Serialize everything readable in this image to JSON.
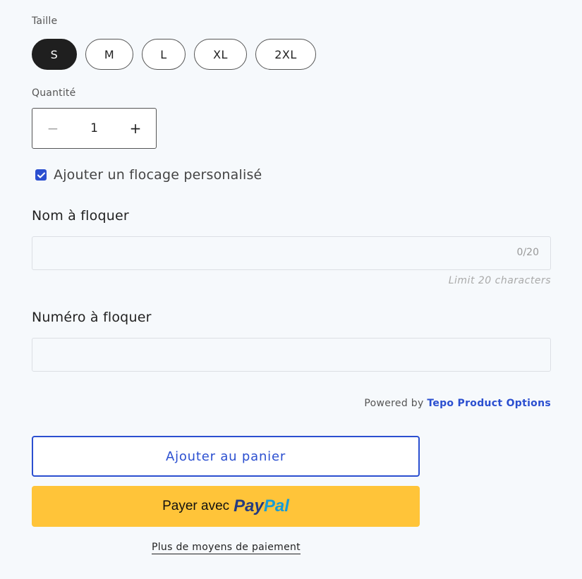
{
  "size": {
    "label": "Taille",
    "options": [
      {
        "label": "S",
        "selected": true
      },
      {
        "label": "M",
        "selected": false
      },
      {
        "label": "L",
        "selected": false
      },
      {
        "label": "XL",
        "selected": false
      },
      {
        "label": "2XL",
        "selected": false
      }
    ]
  },
  "quantity": {
    "label": "Quantité",
    "value": "1",
    "minus": "−",
    "plus": "+"
  },
  "flocage": {
    "checked": true,
    "label": "Ajouter un flocage personalisé"
  },
  "name_field": {
    "title": "Nom à floquer",
    "value": "",
    "counter": "0/20",
    "hint": "Limit 20 characters"
  },
  "number_field": {
    "title": "Numéro à floquer",
    "value": ""
  },
  "powered": {
    "prefix": "Powered by",
    "brand": "Tepo Product Options"
  },
  "actions": {
    "add_to_cart": "Ajouter au panier",
    "paypal_prefix": "Payer avec",
    "paypal_pay": "Pay",
    "paypal_pal": "Pal",
    "more_payment": "Plus de moyens de paiement"
  },
  "colors": {
    "accent": "#2b4fd0",
    "paypal_yellow": "#ffc439",
    "selected_pill": "#1f1f1f"
  }
}
